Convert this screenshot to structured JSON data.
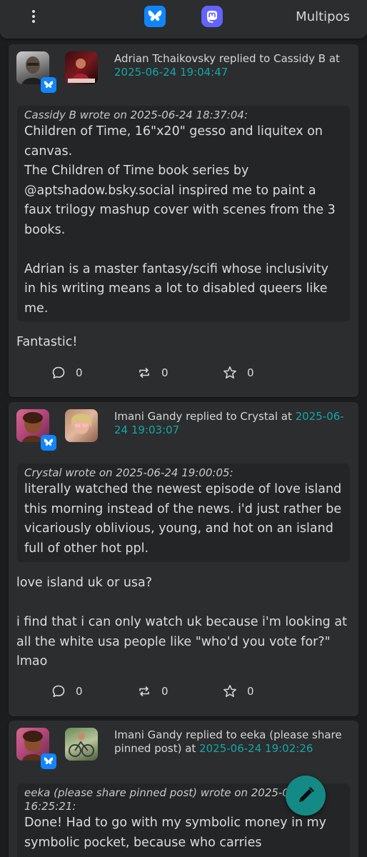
{
  "app": {
    "title": "Multipos"
  },
  "topbar": {
    "menu_icon": "vertical-dots-icon",
    "networks": [
      {
        "name": "Bluesky",
        "icon": "butterfly-icon",
        "color": "#1185fe"
      },
      {
        "name": "Mastodon",
        "icon": "mastodon-icon",
        "color": "#6364ff"
      }
    ]
  },
  "colors": {
    "accent_timestamp": "#12a7a7",
    "card_bg": "#2c2d2f",
    "page_bg": "#1c1d1f",
    "fab": "#138a86"
  },
  "posts": [
    {
      "author": "Adrian Tchaikovsky",
      "header_prefix": "Adrian Tchaikovsky replied to Cassidy B at",
      "timestamp": "2025-06-24 19:04:47",
      "quote_header": "Cassidy B wrote on 2025-06-24 18:37:04:",
      "quote_body": "Children of Time, 16\"x20\" gesso and liquitex on canvas.\nThe Children of Time book series by @aptshadow.bsky.social inspired me to paint a faux trilogy mashup cover with scenes from the 3 books.\n\nAdrian is a master fantasy/scifi whose inclusivity in his writing means a lot to disabled queers like me.",
      "reply": "Fantastic!",
      "replies": "0",
      "reposts": "0",
      "likes": "0"
    },
    {
      "author": "Imani Gandy",
      "header_prefix": "Imani Gandy replied to Crystal at",
      "timestamp": "2025-06-24 19:03:07",
      "quote_header": "Crystal wrote on 2025-06-24 19:00:05:",
      "quote_body": "literally watched the newest episode of love island this morning instead of the news. i'd just rather be vicariously oblivious, young, and hot on an island full of other hot ppl.",
      "reply": "love island uk or usa?\n\ni find that i can only watch uk because i'm looking at all the white usa people like \"who'd you vote for?\" lmao",
      "replies": "0",
      "reposts": "0",
      "likes": "0"
    },
    {
      "author": "Imani Gandy",
      "header_prefix": "Imani Gandy replied to eeka (please share pinned post) at",
      "timestamp": "2025-06-24 19:02:26",
      "quote_header": "eeka (please share pinned post) wrote on 2025-06-24 16:25:21:",
      "quote_body": "Done! Had to go with my symbolic money in my symbolic pocket, because who carries"
    }
  ],
  "fab": {
    "icon": "pencil-icon"
  }
}
